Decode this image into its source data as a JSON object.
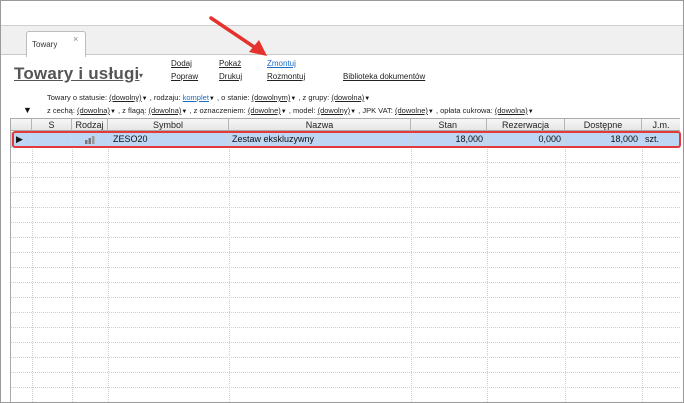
{
  "tab": {
    "label": "Towary",
    "close": "×"
  },
  "title": {
    "text": "Towary i usługi",
    "caret": "▾"
  },
  "actions": {
    "dodaj": "Dodaj",
    "popraw": "Popraw",
    "pokaz": "Pokaż",
    "drukuj": "Drukuj",
    "zmontuj": "Zmontuj",
    "rozmontuj": "Rozmontuj",
    "biblioteka": "Biblioteka dokumentów"
  },
  "filters": {
    "row1": {
      "status_label": "Towary o statusie:",
      "status_value": "(dowolny)",
      "rodzaj_label": ", rodzaju:",
      "rodzaj_value": "komplet",
      "stan_label": ", o stanie:",
      "stan_value": "(dowolnym)",
      "grupa_label": ", z grupy:",
      "grupa_value": "(dowolna)"
    },
    "row2": {
      "cecha_label": "z cechą:",
      "cecha_value": "(dowolna)",
      "flaga_label": ", z flagą:",
      "flaga_value": "(dowolna)",
      "oznaczenie_label": ", z oznaczeniem:",
      "oznaczenie_value": "(dowolne)",
      "model_label": ", model:",
      "model_value": "(dowolny)",
      "jpk_label": ", JPK VAT:",
      "jpk_value": "(dowolne)",
      "oplata_label": ", opłata cukrowa:",
      "oplata_value": "(dowolna)"
    },
    "dropdown_glyph": "▼"
  },
  "grid": {
    "columns": [
      "S",
      "Rodzaj",
      "Symbol",
      "Nazwa",
      "Stan",
      "Rezerwacja",
      "Dostępne",
      "J.m."
    ],
    "rows": [
      {
        "marker": "▶",
        "s": "",
        "rodzaj_icon": "bar-chart-icon",
        "symbol": "ZESO20",
        "nazwa": "Zestaw ekskluzywny",
        "stan": "18,000",
        "rezerwacja": "0,000",
        "dostepne": "18,000",
        "jm": "szt."
      }
    ]
  },
  "colors": {
    "accent_link": "#1a6cc4",
    "selection": "#bcd6f3",
    "highlight_outline": "#e23a3a",
    "arrow": "#e5322d"
  }
}
